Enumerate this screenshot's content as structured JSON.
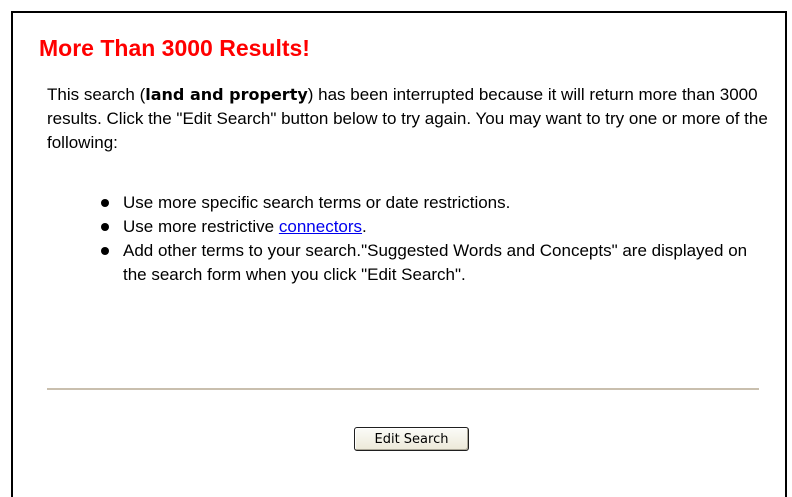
{
  "header": {
    "title": "More Than 3000 Results!"
  },
  "message": {
    "prefix": "This search (",
    "query": "land and property",
    "suffix": ") has been interrupted because it will return more than 3000 results. Click the \"Edit Search\" button below to try again. You may want to try one or more of the following:"
  },
  "tips": [
    {
      "text": "Use more specific search terms or date restrictions."
    },
    {
      "before": "Use more restrictive ",
      "link": "connectors",
      "after": "."
    },
    {
      "text": "Add other terms to your search.\"Suggested Words and Concepts\" are displayed on the search form when you click \"Edit Search\"."
    }
  ],
  "actions": {
    "edit_search_label": "Edit Search"
  },
  "colors": {
    "title": "#ff0000",
    "link": "#0000ee",
    "divider": "#c9bfae"
  }
}
